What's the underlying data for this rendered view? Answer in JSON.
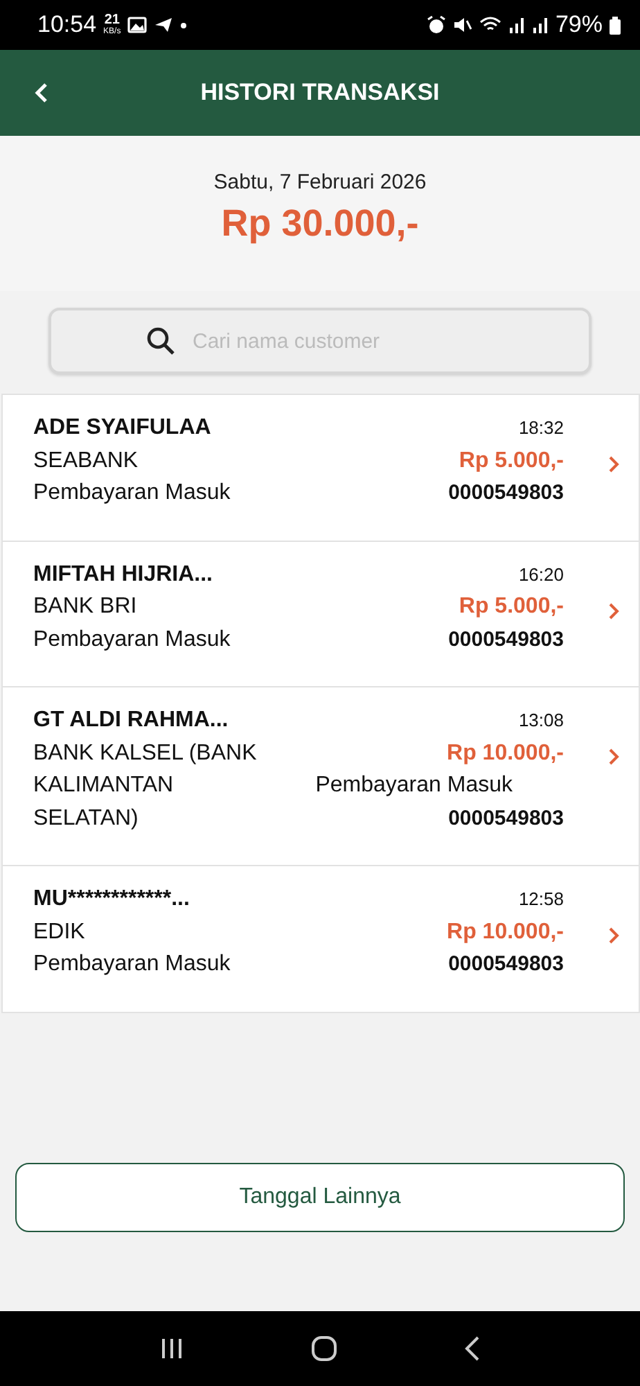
{
  "status_bar": {
    "time": "10:54",
    "speed_value": "21",
    "speed_unit": "KB/s",
    "battery": "79%"
  },
  "header": {
    "title": "HISTORI TRANSAKSI"
  },
  "summary": {
    "date": "Sabtu, 7 Februari 2026",
    "total": "Rp 30.000,-"
  },
  "search": {
    "placeholder": "Cari nama customer"
  },
  "transactions": [
    {
      "kind": "stacked",
      "name": "ADE SYAIFULAA",
      "bank": "SEABANK",
      "type": "Pembayaran Masuk",
      "time": "18:32",
      "amount": "Rp 5.000,-",
      "ref": "0000549803"
    },
    {
      "kind": "stacked",
      "name": "MIFTAH HIJRIA...",
      "bank": "BANK BRI",
      "type": "Pembayaran Masuk",
      "time": "16:20",
      "amount": "Rp 5.000,-",
      "ref": "0000549803"
    },
    {
      "kind": "wrapped",
      "name": "GT ALDI RAHMA...",
      "bank": "BANK KALSEL (BANK KALIMANTAN SELATAN)",
      "type": "Pembayaran Masuk",
      "time": "13:08",
      "amount": "Rp 10.000,-",
      "ref": "0000549803"
    },
    {
      "kind": "stacked",
      "name": "MU************...",
      "bank": "EDIK",
      "type": "Pembayaran Masuk",
      "time": "12:58",
      "amount": "Rp 10.000,-",
      "ref": "0000549803"
    }
  ],
  "more_button": {
    "label": "Tanggal Lainnya"
  }
}
